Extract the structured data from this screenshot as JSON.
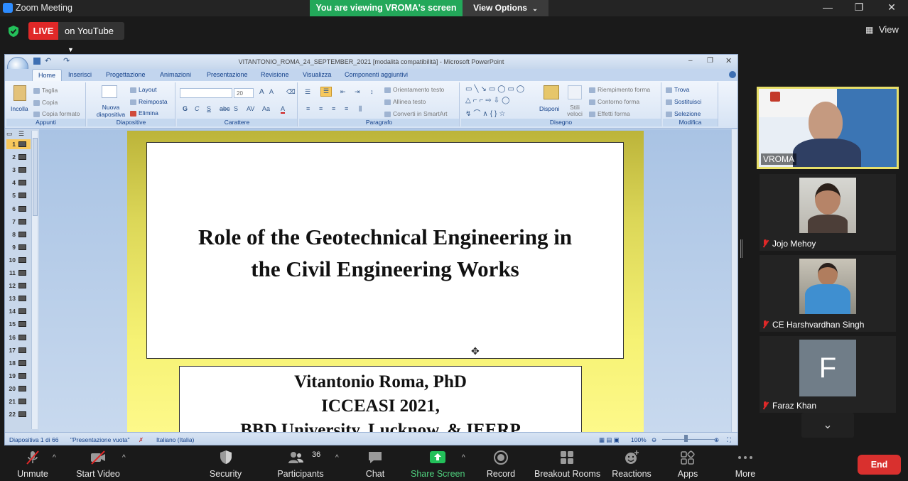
{
  "window": {
    "title": "Zoom Meeting",
    "viewing_banner": "You are viewing VROMA's screen",
    "view_options": "View Options"
  },
  "live": {
    "badge": "LIVE",
    "target": "on YouTube"
  },
  "view_button": "View",
  "ppt": {
    "doc_title": "VITANTONIO_ROMA_24_SEPTEMBER_2021 [modalità compatibilità] - Microsoft PowerPoint",
    "tabs": [
      "Home",
      "Inserisci",
      "Progettazione",
      "Animazioni",
      "Presentazione",
      "Revisione",
      "Visualizza",
      "Componenti aggiuntivi"
    ],
    "ribbon": {
      "appunti": {
        "label": "Appunti",
        "paste": "Incolla",
        "cut": "Taglia",
        "copy": "Copia",
        "format_painter": "Copia formato"
      },
      "diapositive": {
        "label": "Diapositive",
        "new_slide": "Nuova diapositiva",
        "layout": "Layout",
        "reset": "Reimposta",
        "delete": "Elimina"
      },
      "carattere": {
        "label": "Carattere",
        "font_size": "20"
      },
      "paragrafo": {
        "label": "Paragrafo",
        "text_direction": "Orientamento testo",
        "align_text": "Allinea testo",
        "smartart": "Converti in SmartArt"
      },
      "disegno": {
        "label": "Disegno",
        "arrange": "Disponi",
        "quick_styles": "Stili veloci",
        "fill": "Riempimento forma",
        "outline": "Contorno forma",
        "effects": "Effetti forma"
      },
      "modifica": {
        "label": "Modifica",
        "find": "Trova",
        "replace": "Sostituisci",
        "select": "Selezione"
      }
    },
    "thumbnails": [
      "1",
      "2",
      "3",
      "4",
      "5",
      "6",
      "7",
      "8",
      "9",
      "10",
      "11",
      "12",
      "13",
      "14",
      "15",
      "16",
      "17",
      "18",
      "19",
      "20",
      "21",
      "22"
    ],
    "slide": {
      "title_line1": "Role of the Geotechnical Engineering in",
      "title_line2": "the Civil Engineering Works",
      "sub_line1": "Vitantonio Roma, PhD",
      "sub_line2": "ICCEASI 2021,",
      "sub_line3": "BBD University, Lucknow, & IEERP"
    },
    "status": {
      "slide_counter": "Diapositiva 1 di 66",
      "theme": "\"Presentazione vuota\"",
      "language": "Italiano (Italia)",
      "zoom": "100%"
    }
  },
  "participants": [
    {
      "name": "VROMA",
      "active": true
    },
    {
      "name": "Jojo Mehoy",
      "muted": true
    },
    {
      "name": "CE Harshvardhan Singh",
      "muted": true
    },
    {
      "name": "Faraz Khan",
      "muted": true,
      "initial": "F"
    }
  ],
  "toolbar": {
    "unmute": "Unmute",
    "start_video": "Start Video",
    "security": "Security",
    "participants": "Participants",
    "participants_count": "36",
    "chat": "Chat",
    "share_screen": "Share Screen",
    "record": "Record",
    "breakout_rooms": "Breakout Rooms",
    "reactions": "Reactions",
    "apps": "Apps",
    "more": "More",
    "end": "End"
  },
  "colors": {
    "live_red": "#e02828",
    "banner_green": "#23a85a",
    "active_speaker_border": "#e8e06a",
    "share_green": "#23c05a",
    "end_red": "#d9302e"
  }
}
